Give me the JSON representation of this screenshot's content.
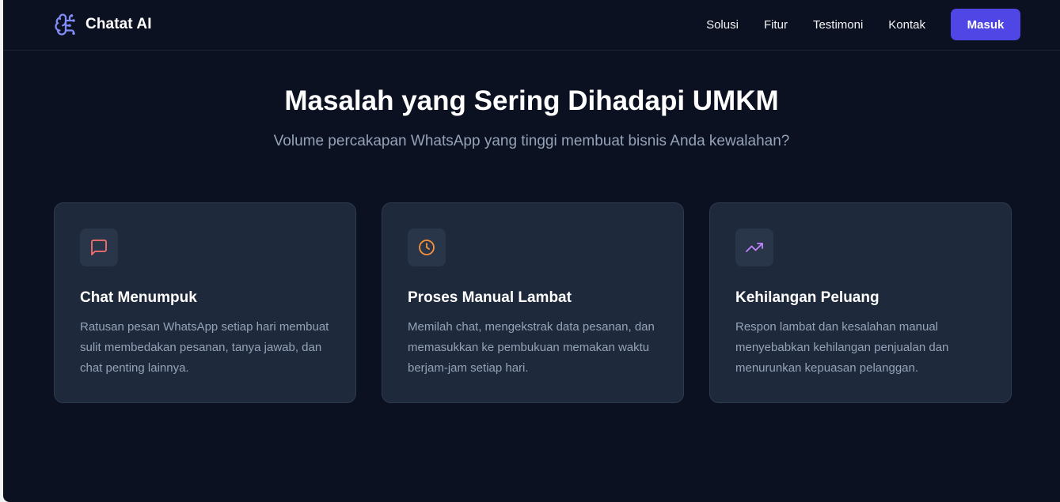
{
  "navbar": {
    "brand_name": "Chatat AI",
    "brand_icon": "brain-icon",
    "links": [
      "Solusi",
      "Fitur",
      "Testimoni",
      "Kontak"
    ],
    "login_label": "Masuk"
  },
  "hero": {
    "title": "Masalah yang Sering Dihadapi UMKM",
    "subtitle": "Volume percakapan WhatsApp yang tinggi membuat bisnis Anda kewalahan?"
  },
  "cards": [
    {
      "icon": "chat-bubble-icon",
      "icon_color": "#f87171",
      "title": "Chat Menumpuk",
      "description": "Ratusan pesan WhatsApp setiap hari membuat sulit membedakan pesanan, tanya jawab, dan chat penting lainnya."
    },
    {
      "icon": "clock-icon",
      "icon_color": "#fb923c",
      "title": "Proses Manual Lambat",
      "description": "Memilah chat, mengekstrak data pesanan, dan memasukkan ke pembukuan memakan waktu berjam-jam setiap hari."
    },
    {
      "icon": "trending-up-icon",
      "icon_color": "#c084fc",
      "title": "Kehilangan Peluang",
      "description": "Respon lambat dan kesalahan manual menyebabkan kehilangan penjualan dan menurunkan kepuasan pelanggan."
    }
  ],
  "colors": {
    "background": "#0b1120",
    "card_background": "#1e293b",
    "accent": "#4f46e5",
    "brand_icon": "#818cf8"
  }
}
